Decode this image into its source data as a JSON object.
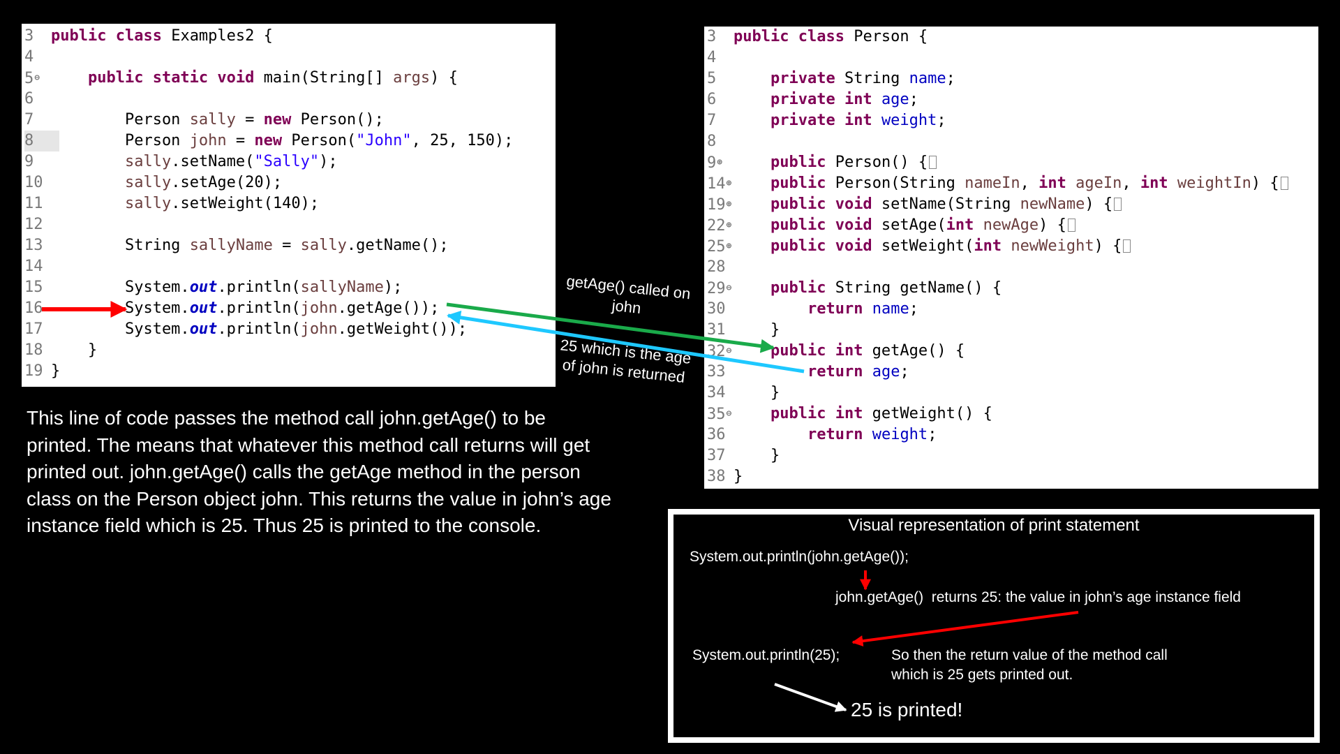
{
  "left_code": {
    "lines": [
      {
        "n": "3",
        "code": "<span class=\"kw\">public class</span> Examples2 {"
      },
      {
        "n": "4",
        "code": ""
      },
      {
        "n": "5",
        "fold": "⊖",
        "code": "    <span class=\"kw\">public static void</span> main(String[] <span class=\"var\">args</span>) {"
      },
      {
        "n": "6",
        "code": ""
      },
      {
        "n": "7",
        "code": "        Person <span class=\"var\">sally</span> = <span class=\"kw\">new</span> Person();"
      },
      {
        "n": "8",
        "selected": true,
        "code": "        Person <span class=\"var\">john</span> = <span class=\"kw\">new</span> Person(<span class=\"str\">\"John\"</span>, 25, 150);"
      },
      {
        "n": "9",
        "code": "        <span class=\"var\">sally</span>.setName(<span class=\"str\">\"Sally\"</span>);"
      },
      {
        "n": "10",
        "code": "        <span class=\"var\">sally</span>.setAge(20);"
      },
      {
        "n": "11",
        "code": "        <span class=\"var\">sally</span>.setWeight(140);"
      },
      {
        "n": "12",
        "code": ""
      },
      {
        "n": "13",
        "code": "        String <span class=\"var\">sallyName</span> = <span class=\"var\">sally</span>.getName();"
      },
      {
        "n": "14",
        "code": ""
      },
      {
        "n": "15",
        "code": "        System.<span class=\"static\">out</span>.println(<span class=\"var\">sallyName</span>);"
      },
      {
        "n": "16",
        "code": "        System.<span class=\"static\">out</span>.println(<span class=\"var\">john</span>.getAge());"
      },
      {
        "n": "17",
        "code": "        System.<span class=\"static\">out</span>.println(<span class=\"var\">john</span>.getWeight());"
      },
      {
        "n": "18",
        "code": "    }"
      },
      {
        "n": "19",
        "code": "}"
      }
    ]
  },
  "right_code": {
    "lines": [
      {
        "n": "3",
        "code": "<span class=\"kw\">public class</span> Person {"
      },
      {
        "n": "4",
        "code": ""
      },
      {
        "n": "5",
        "code": "    <span class=\"kw\">private</span> String <span class=\"fld\">name</span>;"
      },
      {
        "n": "6",
        "code": "    <span class=\"kw\">private int</span> <span class=\"fld\">age</span>;"
      },
      {
        "n": "7",
        "code": "    <span class=\"kw\">private int</span> <span class=\"fld\">weight</span>;"
      },
      {
        "n": "8",
        "code": ""
      },
      {
        "n": "9",
        "fold": "⊕",
        "code": "    <span class=\"kw\">public</span> Person() {<span class=\"box\"></span>"
      },
      {
        "n": "14",
        "fold": "⊕",
        "code": "    <span class=\"kw\">public</span> Person(String <span class=\"var\">nameIn</span>, <span class=\"kw\">int</span> <span class=\"var\">ageIn</span>, <span class=\"kw\">int</span> <span class=\"var\">weightIn</span>) {<span class=\"box\"></span>"
      },
      {
        "n": "19",
        "fold": "⊕",
        "code": "    <span class=\"kw\">public void</span> setName(String <span class=\"var\">newName</span>) {<span class=\"box\"></span>"
      },
      {
        "n": "22",
        "fold": "⊕",
        "code": "    <span class=\"kw\">public void</span> setAge(<span class=\"kw\">int</span> <span class=\"var\">newAge</span>) {<span class=\"box\"></span>"
      },
      {
        "n": "25",
        "fold": "⊕",
        "code": "    <span class=\"kw\">public void</span> setWeight(<span class=\"kw\">int</span> <span class=\"var\">newWeight</span>) {<span class=\"box\"></span>"
      },
      {
        "n": "28",
        "code": ""
      },
      {
        "n": "29",
        "fold": "⊖",
        "code": "    <span class=\"kw\">public</span> String getName() {"
      },
      {
        "n": "30",
        "code": "        <span class=\"kw\">return</span> <span class=\"fld\">name</span>;"
      },
      {
        "n": "31",
        "code": "    }"
      },
      {
        "n": "32",
        "fold": "⊖",
        "code": "    <span class=\"kw\">public int</span> getAge() {"
      },
      {
        "n": "33",
        "code": "        <span class=\"kw\">return</span> <span class=\"fld\">age</span>;"
      },
      {
        "n": "34",
        "code": "    }"
      },
      {
        "n": "35",
        "fold": "⊖",
        "code": "    <span class=\"kw\">public int</span> getWeight() {"
      },
      {
        "n": "36",
        "code": "        <span class=\"kw\">return</span> <span class=\"fld\">weight</span>;"
      },
      {
        "n": "37",
        "code": "    }"
      },
      {
        "n": "38",
        "code": "}"
      }
    ]
  },
  "annotations": {
    "call_line1": "getAge() called on",
    "call_line2": "john",
    "return_line1": "25 which is the age",
    "return_line2": "of john is returned"
  },
  "explanation": {
    "lines": [
      "This line of code passes the method call john.getAge() to be",
      "printed. The means that whatever this method call returns will get",
      "printed out. john.getAge() calls the getAge method in the person",
      "class on the Person object john. This returns the value in john’s age",
      "instance field which is 25. Thus 25 is printed to the console."
    ]
  },
  "visual": {
    "title": "Visual representation of print statement",
    "statement": "System.out.println(john.getAge());",
    "returns": "john.getAge()  returns 25: the value in john’s age instance field",
    "println25": "System.out.println(25);",
    "then_line1": "So then the return value of the method call",
    "then_line2": "which is 25 gets printed out.",
    "printed": "25 is printed!"
  },
  "colors": {
    "call_arrow": "#1aaa4a",
    "return_arrow": "#1ec8ff",
    "pointer_arrow": "#ff0000"
  }
}
